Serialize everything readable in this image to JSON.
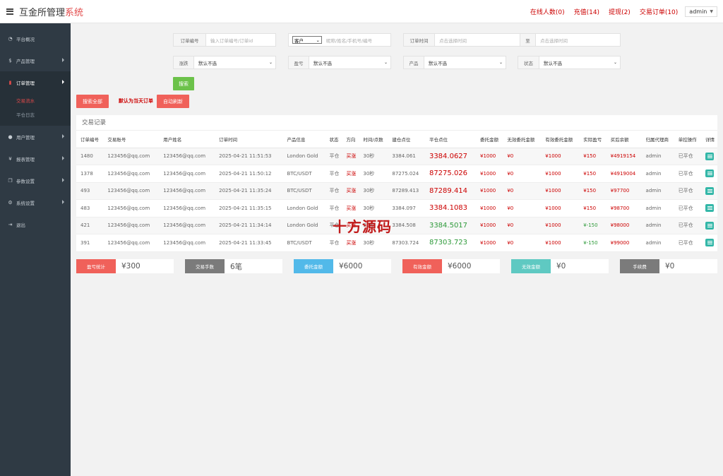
{
  "header": {
    "brand_main": "互金所管理",
    "brand_accent": "系统",
    "links": [
      "在线人数(0)",
      "充值(14)",
      "提现(2)",
      "交易订单(10)"
    ],
    "admin": "admin"
  },
  "sidebar": {
    "items": [
      {
        "label": "平台概况",
        "icon": "dashboard-icon"
      },
      {
        "label": "产品管理",
        "icon": "dollar-icon"
      },
      {
        "label": "订单管理",
        "icon": "order-icon"
      },
      {
        "label": "用户管理",
        "icon": "user-icon"
      },
      {
        "label": "报表管理",
        "icon": "yen-icon"
      },
      {
        "label": "参数设置",
        "icon": "copy-icon"
      },
      {
        "label": "系统设置",
        "icon": "gears-icon"
      },
      {
        "label": "退出",
        "icon": "logout-icon"
      }
    ],
    "sub_items": [
      "交易流水",
      "平仓日志"
    ]
  },
  "filters": {
    "order_no_label": "订单编号",
    "order_no_placeholder": "输入订单编号/订单id",
    "customer_select": "客户",
    "customer_placeholder": "昵称/姓名/手机号/编号",
    "order_time_label": "订单时间",
    "date_placeholder": "点击选择时间",
    "to_label": "至",
    "rise_fall_label": "涨跌",
    "profit_label": "盈亏",
    "product_label": "产品",
    "status_label": "状态",
    "default_option": "默认不选",
    "search_btn": "搜索"
  },
  "actions": {
    "search_all": "搜索全部",
    "default_today": "默认为当天订单",
    "auto_refresh": "自动刷新"
  },
  "table": {
    "title": "交易记录",
    "columns": [
      "订单编号",
      "交易账号",
      "用户姓名",
      "订单时间",
      "产品信息",
      "状态",
      "方向",
      "时间/点数",
      "建仓点位",
      "平仓点位",
      "委托金额",
      "无效委托金额",
      "有效委托金额",
      "实际盈亏",
      "买后余额",
      "归属代理商",
      "单控操作",
      "详情"
    ],
    "rows": [
      {
        "id": "1480",
        "account": "123456@qq.com",
        "name": "123456@qq.com",
        "time": "2025-04-21 11:51:53",
        "product": "London Gold",
        "status": "平仓",
        "direction": "买涨",
        "period": "30秒",
        "open": "3384.061",
        "close": "3384.0627",
        "close_color": "red",
        "amount": "¥1000",
        "invalid": "¥0",
        "valid": "¥1000",
        "pnl": "¥150",
        "pnl_color": "red",
        "balance": "¥4919154",
        "agent": "admin",
        "control": "已平仓"
      },
      {
        "id": "1378",
        "account": "123456@qq.com",
        "name": "123456@qq.com",
        "time": "2025-04-21 11:50:12",
        "product": "BTC/USDT",
        "status": "平仓",
        "direction": "买涨",
        "period": "30秒",
        "open": "87275.024",
        "close": "87275.026",
        "close_color": "red",
        "amount": "¥1000",
        "invalid": "¥0",
        "valid": "¥1000",
        "pnl": "¥150",
        "pnl_color": "red",
        "balance": "¥4919004",
        "agent": "admin",
        "control": "已平仓"
      },
      {
        "id": "493",
        "account": "123456@qq.com",
        "name": "123456@qq.com",
        "time": "2025-04-21 11:35:24",
        "product": "BTC/USDT",
        "status": "平仓",
        "direction": "买涨",
        "period": "30秒",
        "open": "87289.413",
        "close": "87289.414",
        "close_color": "red",
        "amount": "¥1000",
        "invalid": "¥0",
        "valid": "¥1000",
        "pnl": "¥150",
        "pnl_color": "red",
        "balance": "¥97700",
        "agent": "admin",
        "control": "已平仓"
      },
      {
        "id": "483",
        "account": "123456@qq.com",
        "name": "123456@qq.com",
        "time": "2025-04-21 11:35:15",
        "product": "London Gold",
        "status": "平仓",
        "direction": "买涨",
        "period": "30秒",
        "open": "3384.097",
        "close": "3384.1083",
        "close_color": "red",
        "amount": "¥1000",
        "invalid": "¥0",
        "valid": "¥1000",
        "pnl": "¥150",
        "pnl_color": "red",
        "balance": "¥98700",
        "agent": "admin",
        "control": "已平仓"
      },
      {
        "id": "421",
        "account": "123456@qq.com",
        "name": "123456@qq.com",
        "time": "2025-04-21 11:34:14",
        "product": "London Gold",
        "status": "平仓",
        "direction": "买涨",
        "period": "30秒",
        "open": "3384.508",
        "close": "3384.5017",
        "close_color": "green",
        "amount": "¥1000",
        "invalid": "¥0",
        "valid": "¥1000",
        "pnl": "¥-150",
        "pnl_color": "green",
        "balance": "¥98000",
        "agent": "admin",
        "control": "已平仓"
      },
      {
        "id": "391",
        "account": "123456@qq.com",
        "name": "123456@qq.com",
        "time": "2025-04-21 11:33:45",
        "product": "BTC/USDT",
        "status": "平仓",
        "direction": "买涨",
        "period": "30秒",
        "open": "87303.724",
        "close": "87303.723",
        "close_color": "green",
        "amount": "¥1000",
        "invalid": "¥0",
        "valid": "¥1000",
        "pnl": "¥-150",
        "pnl_color": "green",
        "balance": "¥99000",
        "agent": "admin",
        "control": "已平仓"
      }
    ]
  },
  "watermark": "十方源码",
  "stats": [
    {
      "label": "盈亏统计",
      "value": "¥300",
      "color": "#f0615a"
    },
    {
      "label": "交易手数",
      "value": "6笔",
      "color": "#7b7b7b"
    },
    {
      "label": "委托金额",
      "value": "¥6000",
      "color": "#52b9e9"
    },
    {
      "label": "有效金额",
      "value": "¥6000",
      "color": "#f0615a"
    },
    {
      "label": "无效金额",
      "value": "¥0",
      "color": "#5fc9c2"
    },
    {
      "label": "手续费",
      "value": "¥0",
      "color": "#7b7b7b"
    }
  ],
  "colors": {
    "accent": "#e24a4a",
    "green_btn": "#6cc24a",
    "red_btn": "#f0615a"
  }
}
